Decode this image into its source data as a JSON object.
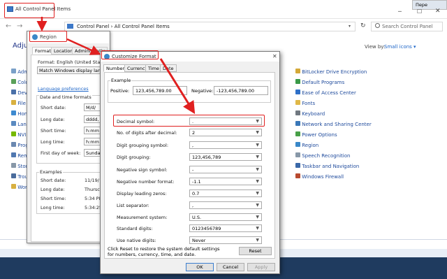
{
  "cp": {
    "title": "All Control Panel Items",
    "language_btn": "Пере",
    "breadcrumb": [
      "Control Panel",
      "All Control Panel Items"
    ],
    "search_placeholder": "Search Control Panel",
    "heading": "Adjust",
    "view_by_label": "View by:",
    "view_by_value": "Small icons",
    "left_items": [
      "Adm",
      "Colo",
      "Dev",
      "File",
      "Hom",
      "Lang",
      "NVI",
      "Prog",
      "Rem",
      "Stor",
      "Trou",
      "Wor"
    ],
    "right_items": [
      "BitLocker Drive Encryption",
      "Default Programs",
      "Ease of Access Center",
      "Fonts",
      "Keyboard",
      "Network and Sharing Center",
      "Power Options",
      "Region",
      "Speech Recognition",
      "Taskbar and Navigation",
      "Windows Firewall"
    ]
  },
  "region": {
    "title": "Region",
    "tabs": [
      "Formats",
      "Location",
      "Administrativ"
    ],
    "format_label": "Format: English (United States",
    "match_label": "Match Windows display lang",
    "lang_pref": "Language preferences",
    "dt_header": "Date and time formats",
    "rows": [
      {
        "label": "Short date:",
        "value": "M/d/"
      },
      {
        "label": "Long date:",
        "value": "dddd,"
      },
      {
        "label": "Short time:",
        "value": "h:mm"
      },
      {
        "label": "Long time:",
        "value": "h:mm"
      },
      {
        "label": "First day of week:",
        "value": "Sunda"
      }
    ],
    "examples_header": "Examples",
    "examples": [
      {
        "label": "Short date:",
        "value": "11/19/"
      },
      {
        "label": "Long date:",
        "value": "Thursc"
      },
      {
        "label": "Short time:",
        "value": "5:34 PI"
      },
      {
        "label": "Long time:",
        "value": "5:34:25"
      }
    ]
  },
  "cf": {
    "title": "Customize Format",
    "tabs": [
      "Numbers",
      "Currency",
      "Time",
      "Date"
    ],
    "example_label": "Example",
    "positive_label": "Positive:",
    "positive_value": "123,456,789.00",
    "negative_label": "Negative:",
    "negative_value": "-123,456,789.00",
    "rows": [
      {
        "label": "Decimal symbol:",
        "value": "."
      },
      {
        "label": "No. of digits after decimal:",
        "value": "2"
      },
      {
        "label": "Digit grouping symbol:",
        "value": ","
      },
      {
        "label": "Digit grouping:",
        "value": "123,456,789"
      },
      {
        "label": "Negative sign symbol:",
        "value": "-"
      },
      {
        "label": "Negative number format:",
        "value": "-1.1"
      },
      {
        "label": "Display leading zeros:",
        "value": "0.7"
      },
      {
        "label": "List separator:",
        "value": ","
      },
      {
        "label": "Measurement system:",
        "value": "U.S."
      },
      {
        "label": "Standard digits:",
        "value": "0123456789"
      },
      {
        "label": "Use native digits:",
        "value": "Never"
      }
    ],
    "reset_note": "Click Reset to restore the system default settings for numbers, currency, time, and date.",
    "reset_btn": "Reset",
    "ok_btn": "OK",
    "cancel_btn": "Cancel",
    "apply_btn": "Apply"
  }
}
